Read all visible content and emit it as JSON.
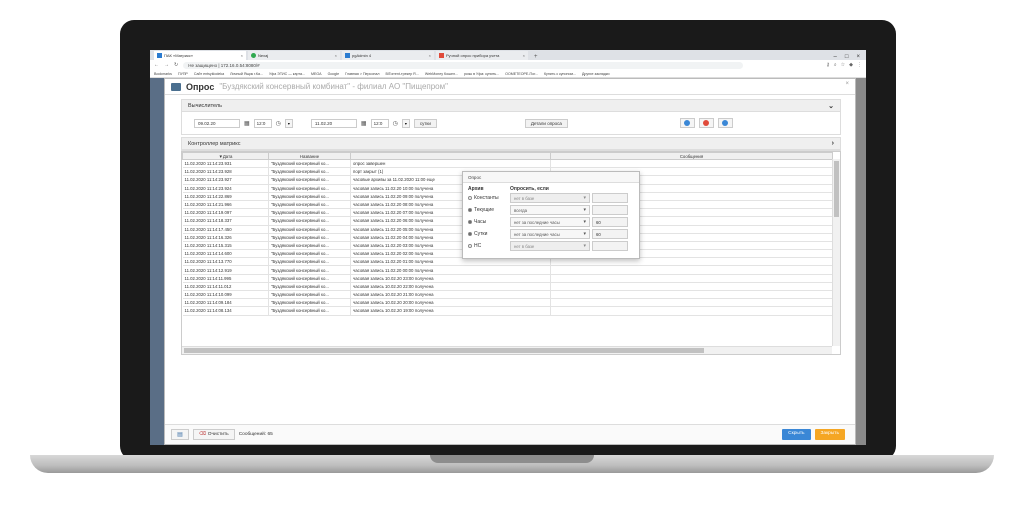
{
  "browser": {
    "tabs": [
      {
        "label": "ПАК «Матрикс»",
        "active": true
      },
      {
        "label": "Nexaj"
      },
      {
        "label": "pgAdmin 4"
      },
      {
        "label": "Ручной опрос прибора учета"
      }
    ],
    "new_tab": "+",
    "address": "Не защищено | 172.16.0.54:8080/#",
    "bookmarks": [
      "Bookmarks",
      "ПУПР",
      "Сайт entsyklodeka",
      "Личный Ящик г.Ка...",
      "Уфа ЭТИС — карта...",
      "MEGA",
      "Google",
      "Главная > Персонал",
      "BiTorrent-трекер R...",
      "WebMoney Кошел...",
      "розы в Уфа: купить...",
      "ООМЕТЕОРЕ-Пог...",
      "Купить с купоном...",
      "Другие закладки"
    ]
  },
  "modal": {
    "title": "Опрос",
    "subtitle": "\"Буздякский консервный комбинат\" - филиал АО \"Пищепром\""
  },
  "calc_panel": {
    "title": "Вычислитель",
    "date_from": "09.02.20",
    "time_from": "12:0",
    "date_to": "11.02.20",
    "time_to": "12:0",
    "days_button": "сутки",
    "details_button": "Детали опроса"
  },
  "controller_panel": {
    "title": "Контроллер матрикс"
  },
  "table": {
    "headers": [
      "▼Дата",
      "Название",
      "",
      "Сообщения"
    ],
    "rows": [
      [
        "11.02.2020 11:14:23.931",
        "\"Буздякский консервный ко...",
        "опрос завершен"
      ],
      [
        "11.02.2020 11:14:23.928",
        "\"Буздякский консервный ко...",
        "порт закрыт (1)"
      ],
      [
        "11.02.2020 11:14:23.927",
        "\"Буздякский консервный ко...",
        "часовые архивы за 11.02.2020 11:00 еще"
      ],
      [
        "11.02.2020 11:14:23.924",
        "\"Буздякский консервный ко...",
        "часовая запись 11.02.20 10:00 получена"
      ],
      [
        "11.02.2020 11:14:22.869",
        "\"Буздякский консервный ко...",
        "часовая запись 11.02.20 09:00 получена"
      ],
      [
        "11.02.2020 11:14:21.966",
        "\"Буздякский консервный ко...",
        "часовая запись 11.02.20 08:00 получена"
      ],
      [
        "11.02.2020 11:14:19.097",
        "\"Буздякский консервный ко...",
        "часовая запись 11.02.20 07:00 получена"
      ],
      [
        "11.02.2020 11:14:18.337",
        "\"Буздякский консервный ко...",
        "часовая запись 11.02.20 06:00 получена"
      ],
      [
        "11.02.2020 11:14:17.450",
        "\"Буздякский консервный ко...",
        "часовая запись 11.02.20 05:00 получена"
      ],
      [
        "11.02.2020 11:14:16.326",
        "\"Буздякский консервный ко...",
        "часовая запись 11.02.20 04:00 получена"
      ],
      [
        "11.02.2020 11:14:15.315",
        "\"Буздякский консервный ко...",
        "часовая запись 11.02.20 03:00 получена"
      ],
      [
        "11.02.2020 11:14:14.600",
        "\"Буздякский консервный ко...",
        "часовая запись 11.02.20 02:00 получена"
      ],
      [
        "11.02.2020 11:14:13.770",
        "\"Буздякский консервный ко...",
        "часовая запись 11.02.20 01:00 получена"
      ],
      [
        "11.02.2020 11:14:12.919",
        "\"Буздякский консервный ко...",
        "часовая запись 11.02.20 00:00 получена"
      ],
      [
        "11.02.2020 11:14:11.995",
        "\"Буздякский консервный ко...",
        "часовая запись 10.02.20 23:00 получена"
      ],
      [
        "11.02.2020 11:14:11.012",
        "\"Буздякский консервный ко...",
        "часовая запись 10.02.20 22:00 получена"
      ],
      [
        "11.02.2020 11:14:10.099",
        "\"Буздякский консервный ко...",
        "часовая запись 10.02.20 21:00 получена"
      ],
      [
        "11.02.2020 11:14:09.184",
        "\"Буздякский консервный ко...",
        "часовая запись 10.02.20 20:00 получена"
      ],
      [
        "11.02.2020 11:14:08.134",
        "\"Буздякский консервный ко...",
        "часовая запись 10.02.20 19:00 получена"
      ]
    ]
  },
  "popover": {
    "title": "Опрос",
    "col_archive": "Архив",
    "col_condition": "Опросить, если",
    "rows": [
      {
        "label": "Константы",
        "checked": false,
        "condition": "нет в базе",
        "value": "",
        "disabled": true
      },
      {
        "label": "Текущие",
        "checked": true,
        "condition": "всегда",
        "value": "",
        "disabled": false
      },
      {
        "label": "Часы",
        "checked": true,
        "condition": "нет за последние часы",
        "value": "60",
        "disabled": false
      },
      {
        "label": "Сутки",
        "checked": true,
        "condition": "нет за последние часы",
        "value": "60",
        "disabled": false
      },
      {
        "label": "НС",
        "checked": false,
        "condition": "нет в базе",
        "value": "",
        "disabled": true
      }
    ]
  },
  "footer": {
    "clear_button": "Очистить",
    "messages_label": "Сообщений: 65",
    "hide_button": "Скрыть",
    "close_button": "Закрыть"
  },
  "colors": {
    "accent_blue": "#3a87d6",
    "accent_orange": "#f5a623",
    "sidebar": "#5a6e86"
  }
}
